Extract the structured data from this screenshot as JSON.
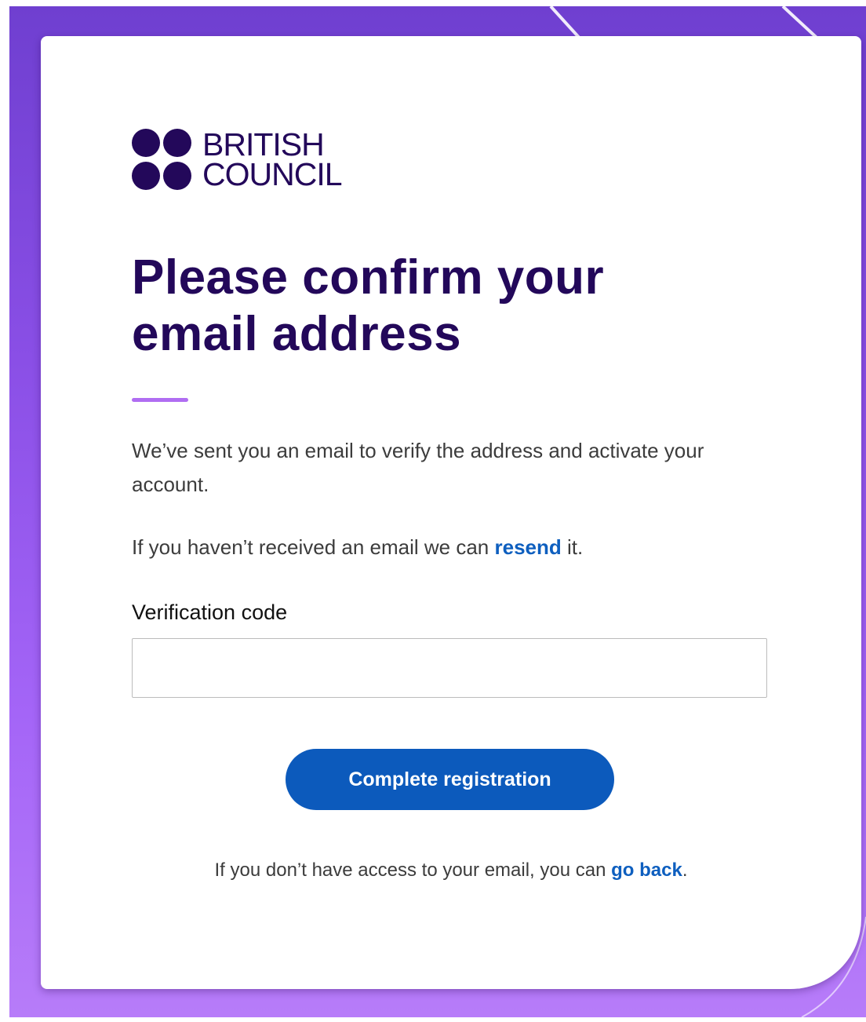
{
  "colors": {
    "brand": "#23085a",
    "accent": "#b06df2",
    "primary_button": "#0c5abc",
    "link": "#0e5fbf"
  },
  "logo": {
    "line1": "BRITISH",
    "line2": "COUNCIL"
  },
  "page_title": "Please confirm your email address",
  "intro": "We’ve sent you an email to verify the address and activate your account.",
  "resend": {
    "before": "If you haven’t received an email we can ",
    "link": "resend",
    "after": " it."
  },
  "verification": {
    "label": "Verification code",
    "value": "",
    "placeholder": ""
  },
  "submit_label": "Complete registration",
  "footer": {
    "before": "If you don’t have access to your email, you can ",
    "link": "go back",
    "after": "."
  }
}
